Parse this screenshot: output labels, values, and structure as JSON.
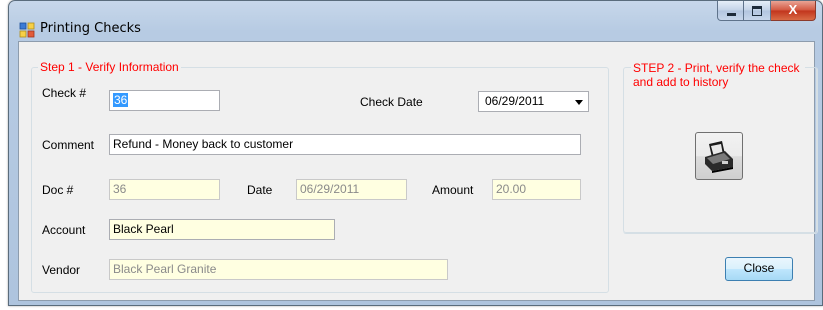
{
  "window": {
    "title": "Printing Checks",
    "close_glyph": "X"
  },
  "step1": {
    "legend": "Step 1 - Verify Information",
    "check_no_label": "Check #",
    "check_no_value": "36",
    "check_date_label": "Check Date",
    "check_date_value": "06/29/2011",
    "comment_label": "Comment",
    "comment_value": "Refund - Money back to customer",
    "doc_no_label": "Doc #",
    "doc_no_value": "36",
    "date_label": "Date",
    "date_value": "06/29/2011",
    "amount_label": "Amount",
    "amount_value": "20.00",
    "account_label": "Account",
    "account_value": "Black Pearl",
    "vendor_label": "Vendor",
    "vendor_value": "Black Pearl Granite"
  },
  "step2": {
    "legend": "STEP 2 - Print, verify the check and add to history",
    "print_icon": "printer-icon"
  },
  "buttons": {
    "close_label": "Close"
  },
  "colors": {
    "legend_red": "#ff0000",
    "readonly_bg": "#ffffe1",
    "selection": "#3399ff"
  }
}
